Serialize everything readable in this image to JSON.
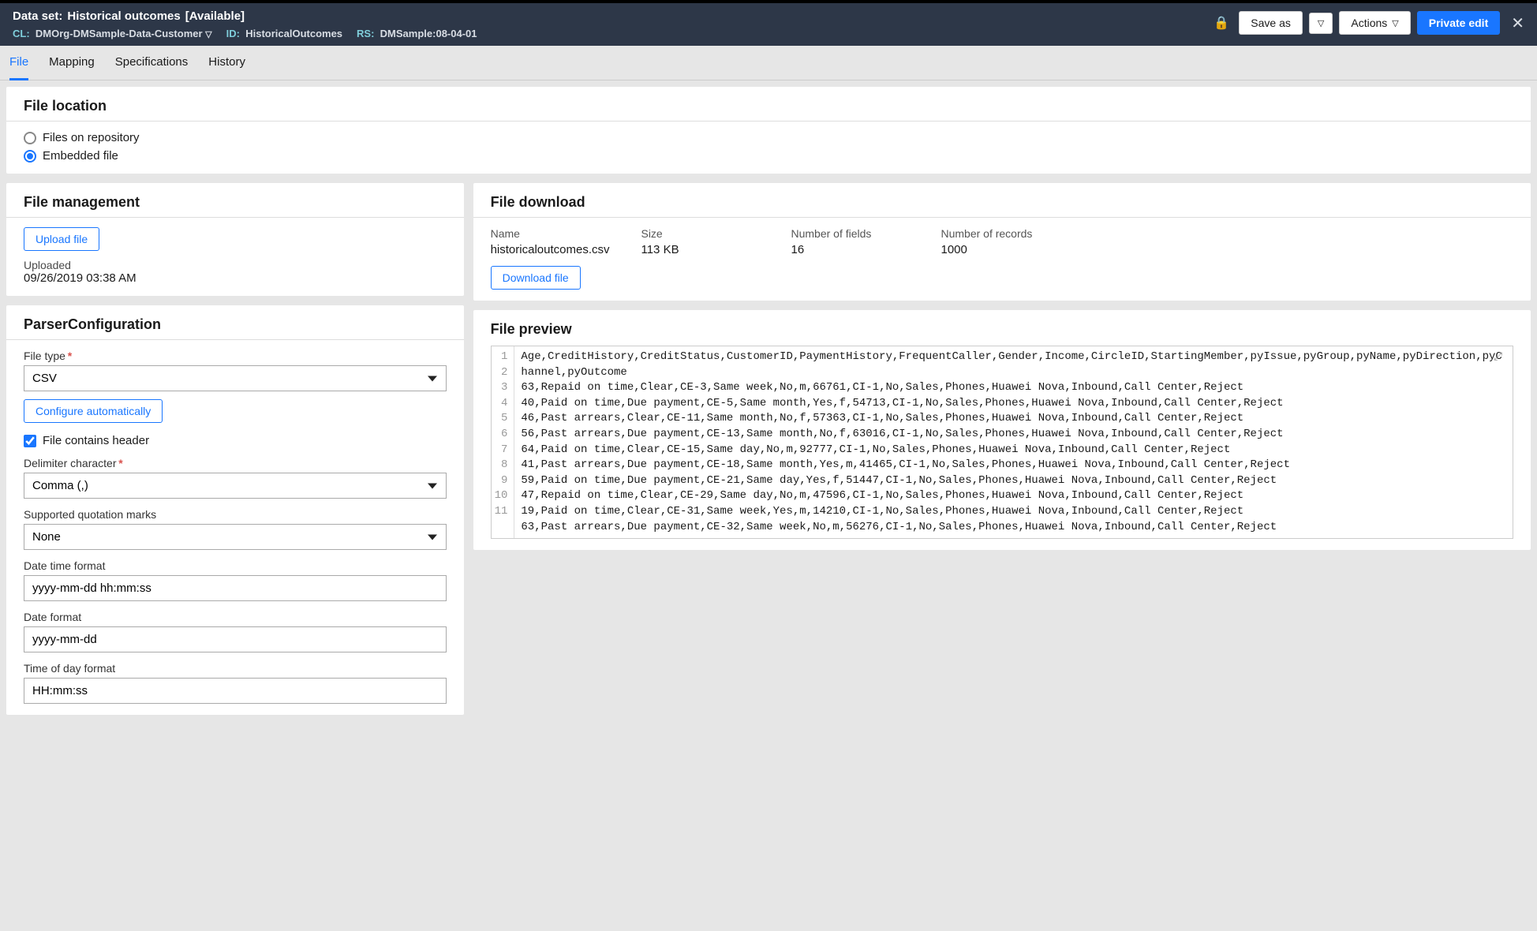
{
  "header": {
    "title_prefix": "Data set:",
    "title_name": "Historical outcomes",
    "title_status": "[Available]",
    "cl_label": "CL:",
    "cl_value": "DMOrg-DMSample-Data-Customer",
    "id_label": "ID:",
    "id_value": "HistoricalOutcomes",
    "rs_label": "RS:",
    "rs_value": "DMSample:08-04-01",
    "save_as": "Save as",
    "actions": "Actions",
    "private_edit": "Private edit"
  },
  "tabs": {
    "file": "File",
    "mapping": "Mapping",
    "specifications": "Specifications",
    "history": "History"
  },
  "file_location": {
    "title": "File location",
    "opt_repo": "Files on repository",
    "opt_embedded": "Embedded file"
  },
  "file_mgmt": {
    "title": "File management",
    "upload_btn": "Upload file",
    "uploaded_label": "Uploaded",
    "uploaded_value": "09/26/2019 03:38 AM"
  },
  "file_download": {
    "title": "File download",
    "name_label": "Name",
    "name_value": "historicaloutcomes.csv",
    "size_label": "Size",
    "size_value": "113 KB",
    "fields_label": "Number of fields",
    "fields_value": "16",
    "records_label": "Number of records",
    "records_value": "1000",
    "download_btn": "Download file"
  },
  "parser": {
    "title": "ParserConfiguration",
    "file_type_label": "File type",
    "file_type_value": "CSV",
    "configure_btn": "Configure automatically",
    "contains_header": "File contains header",
    "delim_label": "Delimiter character",
    "delim_value": "Comma (,)",
    "quote_label": "Supported quotation marks",
    "quote_value": "None",
    "dt_label": "Date time format",
    "dt_value": "yyyy-mm-dd hh:mm:ss",
    "date_label": "Date format",
    "date_value": "yyyy-mm-dd",
    "time_label": "Time of day format",
    "time_value": "HH:mm:ss"
  },
  "preview": {
    "title": "File preview",
    "line1": "Age,CreditHistory,CreditStatus,CustomerID,PaymentHistory,FrequentCaller,Gender,Income,CircleID,StartingMember,pyIssue,pyGroup,pyName,pyDirection,pyChannel,pyOutcome",
    "lines": [
      "63,Repaid on time,Clear,CE-3,Same week,No,m,66761,CI-1,No,Sales,Phones,Huawei Nova,Inbound,Call Center,Reject",
      "40,Paid on time,Due payment,CE-5,Same month,Yes,f,54713,CI-1,No,Sales,Phones,Huawei Nova,Inbound,Call Center,Reject",
      "46,Past arrears,Clear,CE-11,Same month,No,f,57363,CI-1,No,Sales,Phones,Huawei Nova,Inbound,Call Center,Reject",
      "56,Past arrears,Due payment,CE-13,Same month,No,f,63016,CI-1,No,Sales,Phones,Huawei Nova,Inbound,Call Center,Reject",
      "64,Paid on time,Clear,CE-15,Same day,No,m,92777,CI-1,No,Sales,Phones,Huawei Nova,Inbound,Call Center,Reject",
      "41,Past arrears,Due payment,CE-18,Same month,Yes,m,41465,CI-1,No,Sales,Phones,Huawei Nova,Inbound,Call Center,Reject",
      "59,Paid on time,Due payment,CE-21,Same day,Yes,f,51447,CI-1,No,Sales,Phones,Huawei Nova,Inbound,Call Center,Reject",
      "47,Repaid on time,Clear,CE-29,Same day,No,m,47596,CI-1,No,Sales,Phones,Huawei Nova,Inbound,Call Center,Reject",
      "19,Paid on time,Clear,CE-31,Same week,Yes,m,14210,CI-1,No,Sales,Phones,Huawei Nova,Inbound,Call Center,Reject",
      "63,Past arrears,Due payment,CE-32,Same week,No,m,56276,CI-1,No,Sales,Phones,Huawei Nova,Inbound,Call Center,Reject"
    ]
  }
}
